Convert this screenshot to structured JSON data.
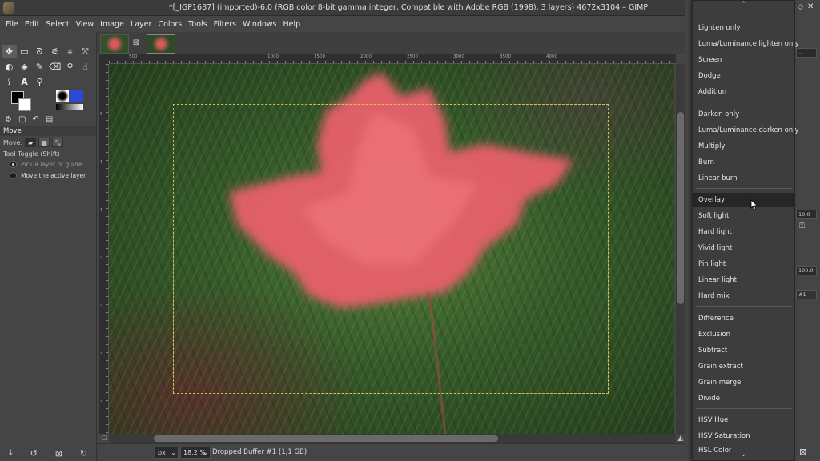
{
  "window": {
    "title": "*[_IGP1687] (imported)-6.0 (RGB color 8-bit gamma integer, Compatible with Adobe RGB (1998), 3 layers) 4672x3104 – GIMP"
  },
  "menubar": [
    "File",
    "Edit",
    "Select",
    "View",
    "Image",
    "Layer",
    "Colors",
    "Tools",
    "Filters",
    "Windows",
    "Help"
  ],
  "tool_options": {
    "header": "Move",
    "move_label": "Move:",
    "toggle_label": "Tool Toggle  (Shift)",
    "options": [
      "Pick a layer or guide",
      "Move the active layer"
    ]
  },
  "rulers": {
    "top": [
      "500",
      "1000",
      "1500",
      "2000",
      "2500",
      "3000",
      "3500",
      "4000"
    ],
    "left": [
      "5",
      "1",
      "1",
      "2",
      "2",
      "3",
      "3"
    ]
  },
  "statusbar": {
    "unit": "px",
    "zoom": "18.2 %",
    "message": "Dropped Buffer #1 (1,1 GB)"
  },
  "blend_menu": {
    "groups": [
      [
        "Lighten only",
        "Luma/Luminance lighten only",
        "Screen",
        "Dodge",
        "Addition"
      ],
      [
        "Darken only",
        "Luma/Luminance darken only",
        "Multiply",
        "Burn",
        "Linear burn"
      ],
      [
        "Overlay",
        "Soft light",
        "Hard light",
        "Vivid light",
        "Pin light",
        "Linear light",
        "Hard mix"
      ],
      [
        "Difference",
        "Exclusion",
        "Subtract",
        "Grain extract",
        "Grain merge",
        "Divide"
      ],
      [
        "HSV Hue",
        "HSV Saturation",
        "HSL Color"
      ]
    ],
    "highlighted": "Overlay"
  },
  "dock": {
    "opacity": "10.0",
    "opacity2": "100.0",
    "layer_tag": "#1"
  },
  "colors": {
    "accent": "#2a4bd6",
    "leaf": "#e8606a",
    "selection": "#d8c060"
  },
  "icons": {
    "tools": [
      "move-icon",
      "rect-select-icon",
      "lasso-icon",
      "fuzzy-select-icon",
      "crop-icon",
      "unified-transform-icon",
      "warp-icon",
      "bucket-fill-icon",
      "paintbrush-icon",
      "eraser-icon",
      "clone-icon",
      "smudge-icon",
      "paths-icon",
      "text-icon",
      "zoom-icon"
    ]
  }
}
